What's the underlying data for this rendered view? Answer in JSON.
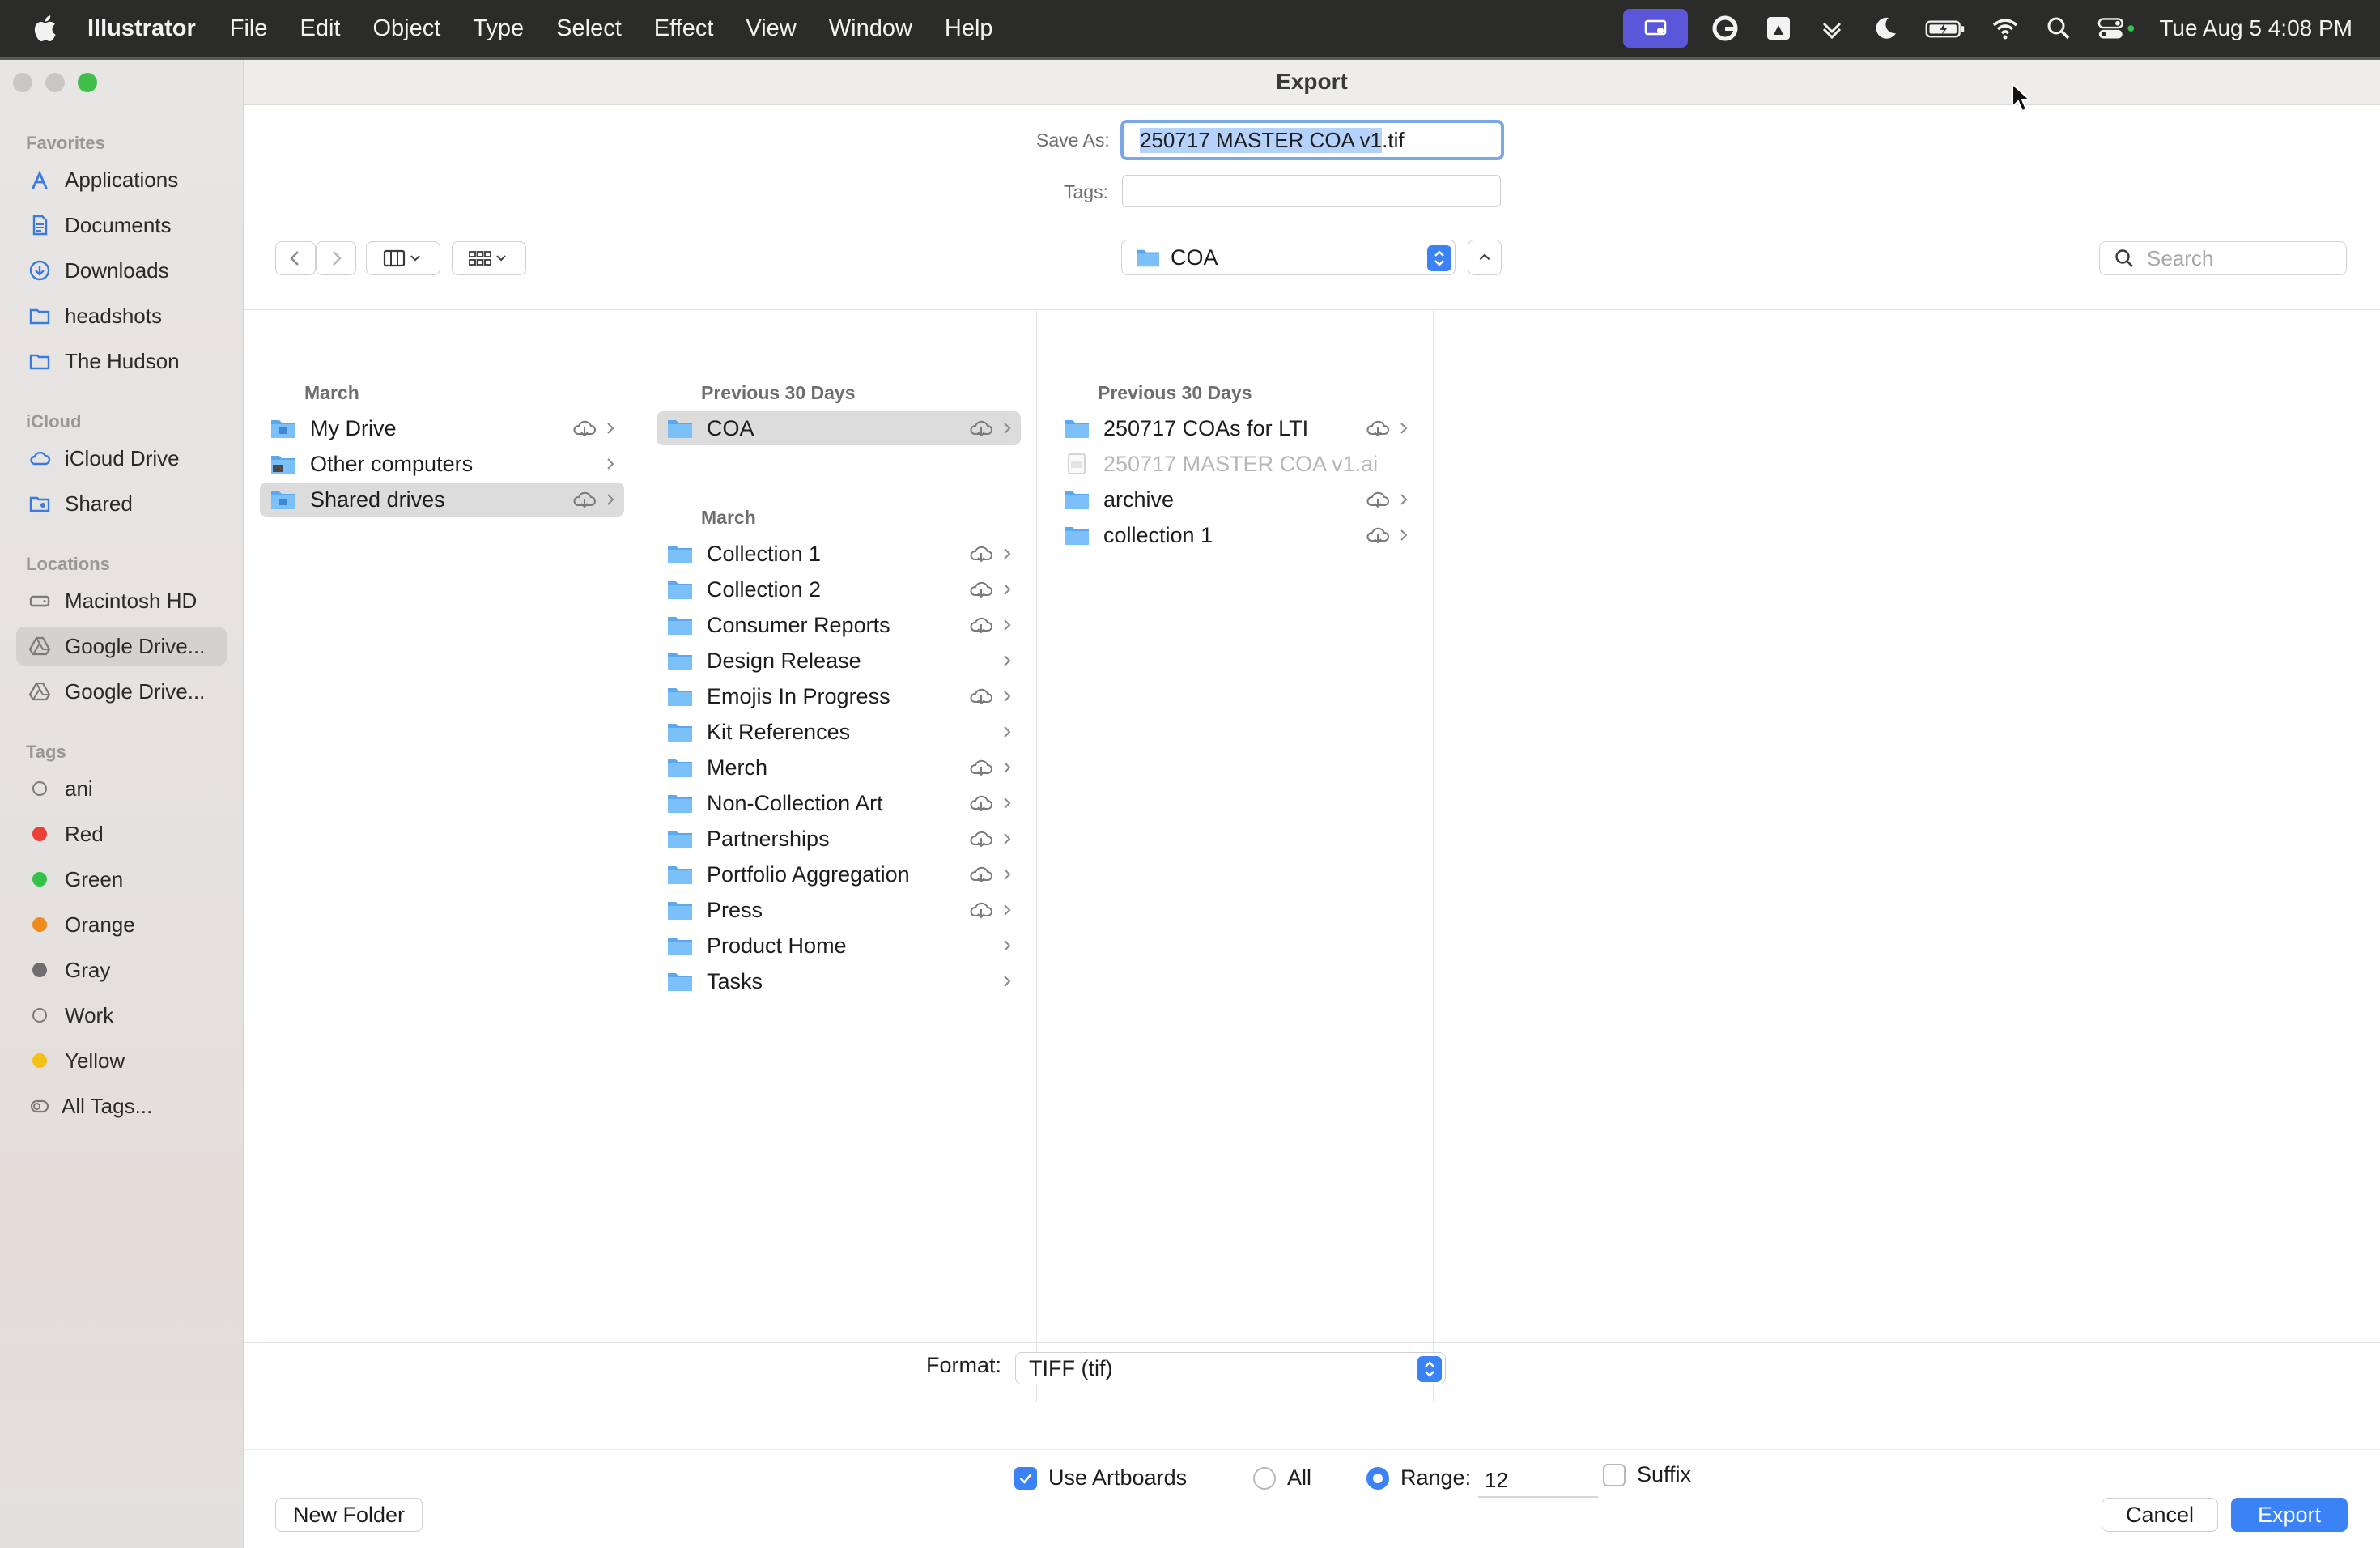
{
  "menubar": {
    "app_name": "Illustrator",
    "items": [
      "File",
      "Edit",
      "Object",
      "Type",
      "Select",
      "Effect",
      "View",
      "Window",
      "Help"
    ],
    "clock": "Tue Aug 5  4:08 PM",
    "status_icons": [
      "screen-share-icon",
      "grammarly-icon",
      "google-drive-icon",
      "chevron-menu-icon",
      "moon-icon",
      "battery-icon",
      "wifi-icon",
      "search-icon",
      "control-center-icon"
    ]
  },
  "sidebar": {
    "favorites_header": "Favorites",
    "favorites": [
      {
        "label": "Applications",
        "icon": "applications-icon"
      },
      {
        "label": "Documents",
        "icon": "document-icon"
      },
      {
        "label": "Downloads",
        "icon": "download-icon"
      },
      {
        "label": "headshots",
        "icon": "folder-icon"
      },
      {
        "label": "The Hudson",
        "icon": "folder-icon"
      }
    ],
    "icloud_header": "iCloud",
    "icloud": [
      {
        "label": "iCloud Drive",
        "icon": "cloud-icon"
      },
      {
        "label": "Shared",
        "icon": "shared-folder-icon"
      }
    ],
    "locations_header": "Locations",
    "locations": [
      {
        "label": "Macintosh HD",
        "icon": "hard-drive-icon"
      },
      {
        "label": "Google Drive...",
        "icon": "google-drive-icon",
        "selected": true
      },
      {
        "label": "Google Drive...",
        "icon": "google-drive-icon"
      }
    ],
    "tags_header": "Tags",
    "tags": [
      {
        "label": "ani",
        "color": "none"
      },
      {
        "label": "Red",
        "color": "#ec3f36"
      },
      {
        "label": "Green",
        "color": "#35c24a"
      },
      {
        "label": "Orange",
        "color": "#f08a1c"
      },
      {
        "label": "Gray",
        "color": "#6e6e70"
      },
      {
        "label": "Work",
        "color": "none"
      },
      {
        "label": "Yellow",
        "color": "#f3c017"
      },
      {
        "label": "All Tags...",
        "color": "all"
      }
    ]
  },
  "dialog": {
    "title": "Export",
    "save_as_label": "Save As:",
    "save_as_selected": "250717 MASTER COA v1",
    "save_as_rest": ".tif",
    "tags_label": "Tags:",
    "tags_value": "",
    "location": "COA",
    "search_placeholder": "Search"
  },
  "browser": {
    "col1": {
      "header": "March",
      "rows": [
        {
          "name": "My Drive",
          "cloud": true
        },
        {
          "name": "Other computers",
          "cloud": false
        },
        {
          "name": "Shared drives",
          "cloud": true,
          "selected": true
        }
      ]
    },
    "col2": {
      "header_recent": "Previous 30 Days",
      "recent": [
        {
          "name": "COA",
          "cloud": true,
          "selected": true
        }
      ],
      "header_march": "March",
      "march": [
        {
          "name": "Collection 1",
          "cloud": true
        },
        {
          "name": "Collection 2",
          "cloud": true
        },
        {
          "name": "Consumer Reports",
          "cloud": true
        },
        {
          "name": "Design Release",
          "cloud": false
        },
        {
          "name": "Emojis In Progress",
          "cloud": true
        },
        {
          "name": "Kit References",
          "cloud": false
        },
        {
          "name": "Merch",
          "cloud": true
        },
        {
          "name": "Non-Collection Art",
          "cloud": true
        },
        {
          "name": "Partnerships",
          "cloud": true
        },
        {
          "name": "Portfolio Aggregation",
          "cloud": true
        },
        {
          "name": "Press",
          "cloud": true
        },
        {
          "name": "Product Home",
          "cloud": false
        },
        {
          "name": "Tasks",
          "cloud": false
        }
      ]
    },
    "col3": {
      "header": "Previous 30 Days",
      "rows": [
        {
          "name": "250717 COAs for LTI",
          "cloud": true,
          "type": "folder"
        },
        {
          "name": "250717 MASTER COA v1.ai",
          "cloud": false,
          "type": "file"
        },
        {
          "name": "archive",
          "cloud": true,
          "type": "folder"
        },
        {
          "name": "collection 1",
          "cloud": true,
          "type": "folder"
        }
      ]
    }
  },
  "options": {
    "format_label": "Format:",
    "format_value": "TIFF (tif)",
    "use_artboards_label": "Use Artboards",
    "use_artboards_checked": true,
    "all_label": "All",
    "range_label": "Range:",
    "range_value": "12",
    "suffix_label": "Suffix"
  },
  "buttons": {
    "new_folder": "New Folder",
    "cancel": "Cancel",
    "export": "Export"
  }
}
